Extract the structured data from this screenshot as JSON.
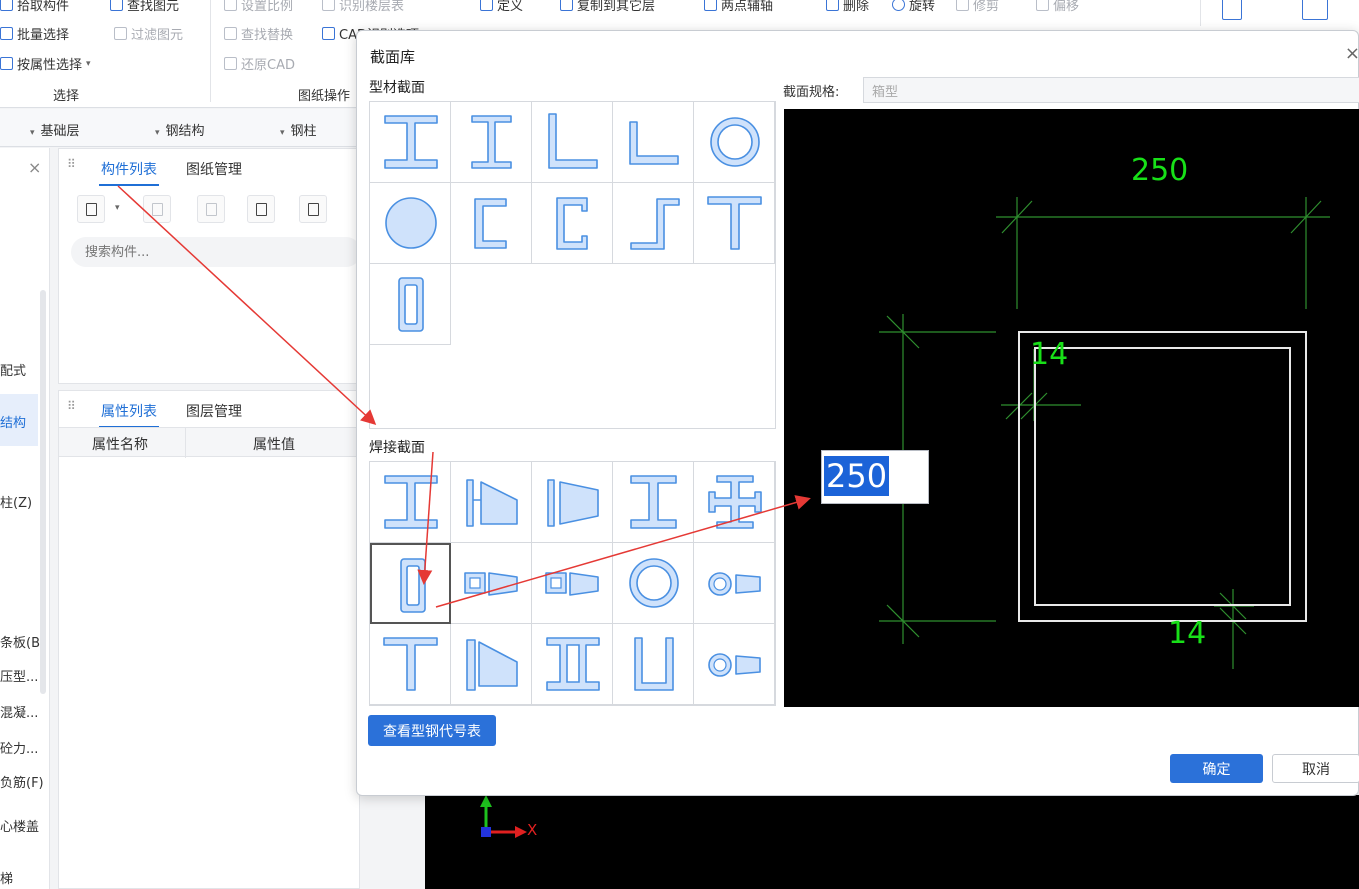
{
  "colors": {
    "accent": "#2b71d9",
    "shape_stroke": "#4a90e2",
    "shape_fill": "#cfe2fb",
    "cad_green": "#18e018",
    "dim_line": "#2f8f2f",
    "arrow": "#e53935"
  },
  "ribbon": {
    "select_group": {
      "items": [
        "拾取构件",
        "批量选择",
        "按属性选择"
      ],
      "find": "查找图元",
      "filter": "过滤图元",
      "label": "选择"
    },
    "drawing_group": {
      "set_scale": "设置比例",
      "identify_floor": "识别楼层表",
      "find_replace": "查找替换",
      "cad_options": "CAD识别选项",
      "restore": "还原CAD",
      "label": "图纸操作"
    },
    "edit_group": {
      "define": "定义",
      "copy_to_floor": "复制到其它层",
      "two_point": "两点辅轴",
      "delete": "删除",
      "rotate": "旋转",
      "trim": "修剪",
      "offset": "偏移"
    }
  },
  "floorbar": {
    "items": [
      "基础层",
      "钢结构",
      "钢柱"
    ]
  },
  "leftpanel": {
    "items": [
      "配式",
      "结构",
      "柱(Z)",
      "条板(B",
      "压型...",
      "混凝...",
      "砼力...",
      "负筋(F)",
      "心楼盖",
      "梯"
    ]
  },
  "comppanel": {
    "tabs": [
      "构件列表",
      "图纸管理"
    ],
    "search_placeholder": "搜索构件..."
  },
  "proppanel": {
    "tabs": [
      "属性列表",
      "图层管理"
    ],
    "col_name": "属性名称",
    "col_value": "属性值"
  },
  "canvas": {
    "axis_x": "X"
  },
  "dialog": {
    "title": "截面库",
    "close": "×",
    "profile_label": "型材截面",
    "weld_label": "焊接截面",
    "spec_label": "截面规格:",
    "spec_value": "箱型",
    "btn_code_table": "查看型钢代号表",
    "btn_ok": "确定",
    "btn_cancel": "取消",
    "preview": {
      "width_dim": "250",
      "height_dim": "250",
      "wall_left": "14",
      "wall_bottom": "14"
    },
    "profile_shapes": [
      "i-beam-icon",
      "h-beam-icon",
      "angle-equal-icon",
      "angle-unequal-icon",
      "pipe-icon",
      "round-bar-icon",
      "channel-icon",
      "c-channel-icon",
      "z-section-icon",
      "t-section-icon",
      "rect-tube-icon"
    ],
    "weld_shapes": [
      "welded-i-icon",
      "tapered-h-icon",
      "tapered-i-icon",
      "welded-h-icon",
      "cross-section-icon",
      "box-section-icon",
      "box-tapered-icon",
      "box-tapered-2-icon",
      "welded-pipe-icon",
      "pipe-tapered-icon",
      "welded-t-icon",
      "tapered-t-icon",
      "double-i-icon",
      "u-section-icon",
      "pipe-tapered-2-icon"
    ],
    "selected_weld_index": 5
  }
}
